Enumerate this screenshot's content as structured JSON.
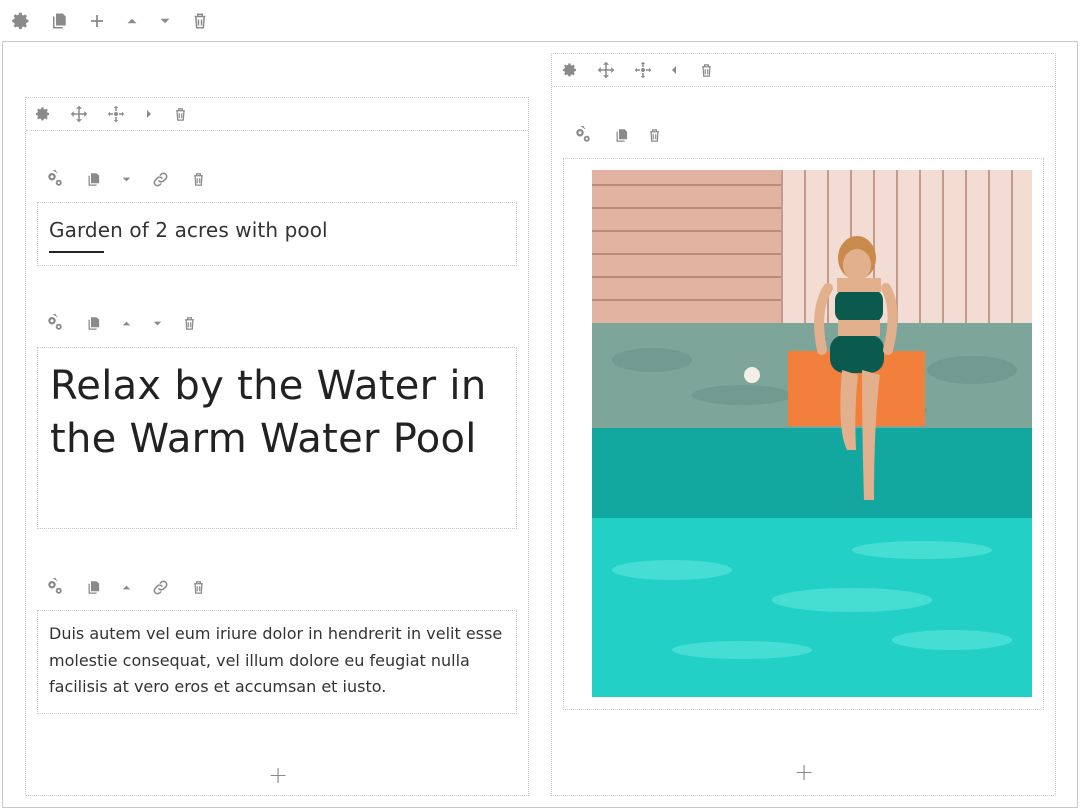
{
  "content": {
    "subtitle": "Garden of 2 acres with pool",
    "heading": "Relax by the Water in the Warm Water Pool",
    "paragraph": "Duis autem vel eum iriure dolor in hendrerit in velit esse molestie consequat, vel illum dolore eu feugiat nulla facilisis at vero eros et accumsan et iusto."
  },
  "add_glyph": "+",
  "colors": {
    "icon": "#8a8a8a",
    "border": "#c9c9c9",
    "pool": "#20cfc6",
    "deck_left": "#e9b9a8",
    "deck_right": "#f2d9cf",
    "stone": "#7fa79c",
    "towel": "#f57f3a"
  },
  "image": {
    "alt": "",
    "icons": [
      "gear-icon",
      "copy-icon",
      "add-icon",
      "move-up-icon",
      "move-down-icon",
      "trash-icon",
      "move-icon",
      "collapse-icon",
      "link-icon"
    ]
  }
}
